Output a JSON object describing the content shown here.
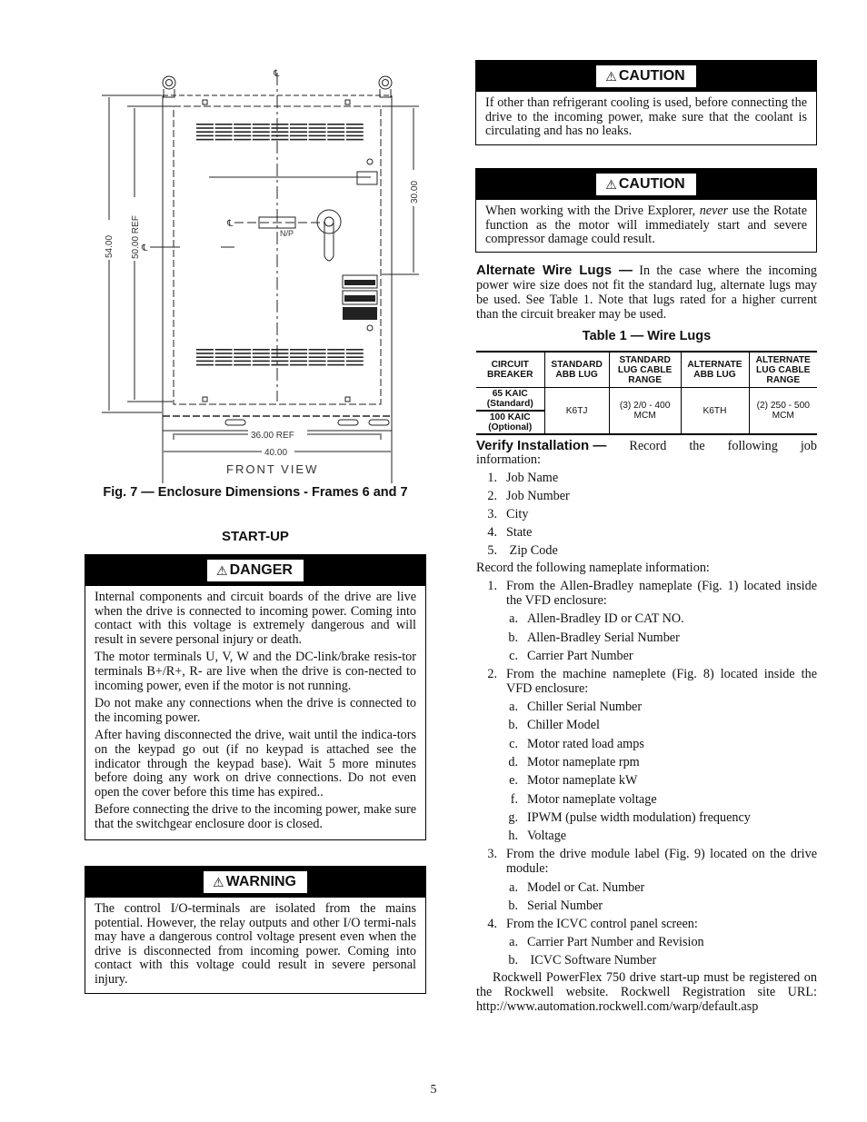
{
  "figure": {
    "dimensions": {
      "overall_height": "54.00",
      "ref_height": "50.00 REF",
      "upper_height": "30.00",
      "ref_width": "36.00 REF",
      "overall_width": "40.00"
    },
    "nameplate_label": "N/P",
    "centerline_symbol": "℄",
    "view_label": "FRONT VIEW",
    "caption": "Fig. 7 — Enclosure Dimensions - Frames 6 and 7"
  },
  "startup_heading": "START-UP",
  "alerts": {
    "danger": {
      "icon": "warning-triangle-icon",
      "label": "DANGER",
      "paragraphs": [
        "Internal components and circuit boards of the drive are live when the drive is connected to incoming power. Coming into contact with this voltage is extremely dangerous and will result in severe personal injury or death.",
        "The motor terminals U, V, W and the DC-link/brake resis-tor terminals B+/R+, R- are live when the drive is con-nected to incoming power, even if the motor is not running.",
        "Do not make any connections when the drive is connected to the incoming power.",
        "After having disconnected the drive, wait until the indica-tors on the keypad go out (if no keypad is attached see the indicator through the keypad base). Wait 5 more minutes before doing any work on drive connections. Do not even open the cover before this time has expired..",
        "Before connecting the drive to the incoming power, make sure that the switchgear enclosure door is closed."
      ]
    },
    "warning": {
      "icon": "warning-triangle-icon",
      "label": "WARNING",
      "paragraphs": [
        "The control I/O-terminals are isolated from the mains potential. However, the relay outputs and other I/O termi-nals may have a dangerous control voltage present even when the drive is disconnected from incoming power. Coming into contact with this voltage could result in severe personal injury."
      ]
    },
    "caution1": {
      "icon": "warning-triangle-icon",
      "label": "CAUTION",
      "text": "If other than refrigerant cooling is used, before connecting the drive to the incoming power, make sure that the coolant is circulating and has no leaks."
    },
    "caution2": {
      "icon": "warning-triangle-icon",
      "label": "CAUTION",
      "text_before": "When working with the Drive Explorer, ",
      "text_emphasis": "never",
      "text_after": " use the Rotate function as the motor will immediately start and severe compressor damage could result."
    }
  },
  "alternate_lugs": {
    "heading": "Alternate Wire Lugs —",
    "text": " In the case where the incoming power wire size does not fit the standard lug, alternate lugs may be used. See Table 1. Note that lugs rated for a higher current than the circuit breaker may be used."
  },
  "table1": {
    "title": "Table 1 — Wire Lugs",
    "headers": [
      "CIRCUIT BREAKER",
      "STANDARD ABB LUG",
      "STANDARD LUG CABLE RANGE",
      "ALTERNATE ABB LUG",
      "ALTERNATE LUG CABLE RANGE"
    ],
    "breakers": [
      "65 KAIC (Standard)",
      "100 KAIC (Optional)"
    ],
    "standard_lug": "K6TJ",
    "standard_range": "(3) 2/0 - 400 MCM",
    "alternate_lug": "K6TH",
    "alternate_range": "(2) 250 - 500 MCM"
  },
  "verify": {
    "heading": "Verify Installation —",
    "intro_words": [
      "Record",
      "the",
      "following",
      "job"
    ],
    "intro_tail": "information:",
    "job_items": [
      {
        "n": "1.",
        "t": "Job Name"
      },
      {
        "n": "2.",
        "t": "Job Number"
      },
      {
        "n": "3.",
        "t": "City"
      },
      {
        "n": "4.",
        "t": "State"
      },
      {
        "n": "5.",
        "t": " Zip Code"
      }
    ],
    "nameplate_intro": "Record the following nameplate information:",
    "nameplate_items": [
      {
        "n": "1.",
        "t": "From the Allen-Bradley nameplate (Fig. 1) located inside the VFD enclosure:",
        "subs": [
          {
            "n": "a.",
            "t": "Allen-Bradley ID or CAT NO."
          },
          {
            "n": "b.",
            "t": "Allen-Bradley Serial Number"
          },
          {
            "n": "c.",
            "t": "Carrier Part Number"
          }
        ]
      },
      {
        "n": "2.",
        "t": "From the machine nameplete (Fig. 8) located inside the VFD enclosure:",
        "subs": [
          {
            "n": "a.",
            "t": "Chiller Serial Number"
          },
          {
            "n": "b.",
            "t": "Chiller Model"
          },
          {
            "n": "c.",
            "t": "Motor rated load amps"
          },
          {
            "n": "d.",
            "t": "Motor nameplate rpm"
          },
          {
            "n": "e.",
            "t": "Motor nameplate kW"
          },
          {
            "n": "f.",
            "t": "Motor nameplate voltage"
          },
          {
            "n": "g.",
            "t": "IPWM (pulse width modulation) frequency"
          },
          {
            "n": "h.",
            "t": "Voltage"
          }
        ]
      },
      {
        "n": "3.",
        "t": "From the drive module label (Fig. 9) located on the drive module:",
        "subs": [
          {
            "n": "a.",
            "t": "Model or Cat. Number"
          },
          {
            "n": "b.",
            "t": "Serial Number"
          }
        ]
      },
      {
        "n": "4.",
        "t": "From the ICVC control panel screen:",
        "subs": [
          {
            "n": "a.",
            "t": "Carrier Part Number and Revision"
          },
          {
            "n": "b.",
            "t": " ICVC Software Number"
          }
        ]
      }
    ],
    "closing": "Rockwell PowerFlex 750 drive start-up must be registered on the Rockwell website. Rockwell Registration site URL: http://www.automation.rockwell.com/warp/default.asp"
  },
  "page_number": "5"
}
